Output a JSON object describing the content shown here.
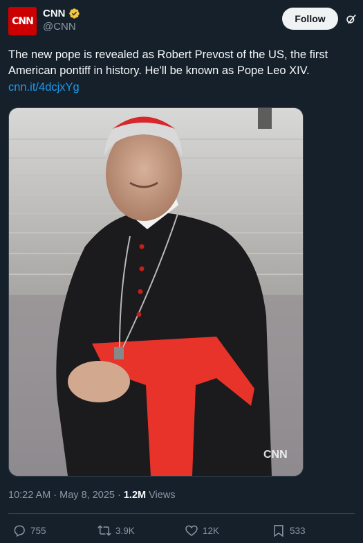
{
  "author": {
    "avatar_text": "CNN",
    "name": "CNN",
    "handle": "@CNN",
    "verified": true,
    "verified_color": "#f4c63d"
  },
  "follow_label": "Follow",
  "tweet": {
    "text": "The new pope is revealed as Robert Prevost of the US, the first American pontiff in history. He'll be known as Pope Leo XIV.",
    "link": "cnn.it/4dcjxYg"
  },
  "media": {
    "watermark": "CNN"
  },
  "meta": {
    "time": "10:22 AM",
    "sep1": " · ",
    "date": "May 8, 2025",
    "sep2": " · ",
    "views_count": "1.2M",
    "views_label": " Views"
  },
  "actions": {
    "replies": "755",
    "reposts": "3.9K",
    "likes": "12K",
    "bookmarks": "533"
  },
  "colors": {
    "background": "#15202b",
    "link": "#1d9bf0",
    "brand": "#cc0000"
  }
}
